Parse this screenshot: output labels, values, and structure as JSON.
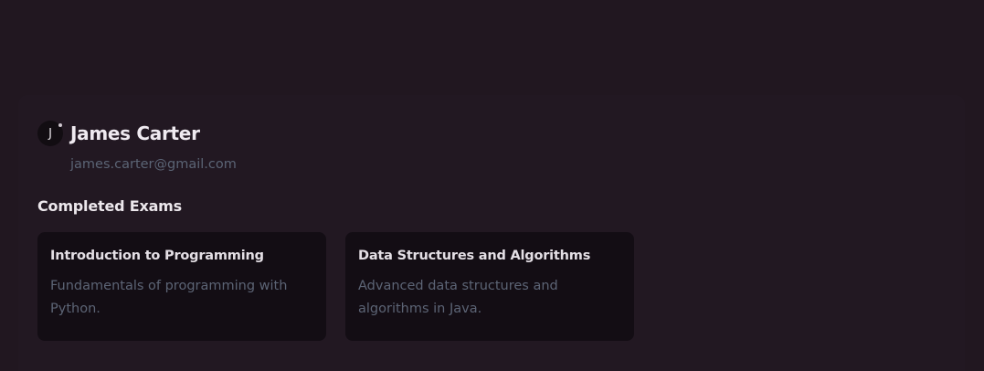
{
  "profile": {
    "avatar_initial": "J",
    "name": "James Carter",
    "email": "james.carter@gmail.com"
  },
  "completed_exams": {
    "heading": "Completed Exams",
    "items": [
      {
        "title": "Introduction to Programming",
        "description": "Fundamentals of programming with Python."
      },
      {
        "title": "Data Structures and Algorithms",
        "description": "Advanced data structures and algorithms in Java."
      }
    ]
  },
  "colors": {
    "background": "#211720",
    "card": "#130d14",
    "muted_text": "#5c6475",
    "primary_text": "#efeaf0"
  }
}
